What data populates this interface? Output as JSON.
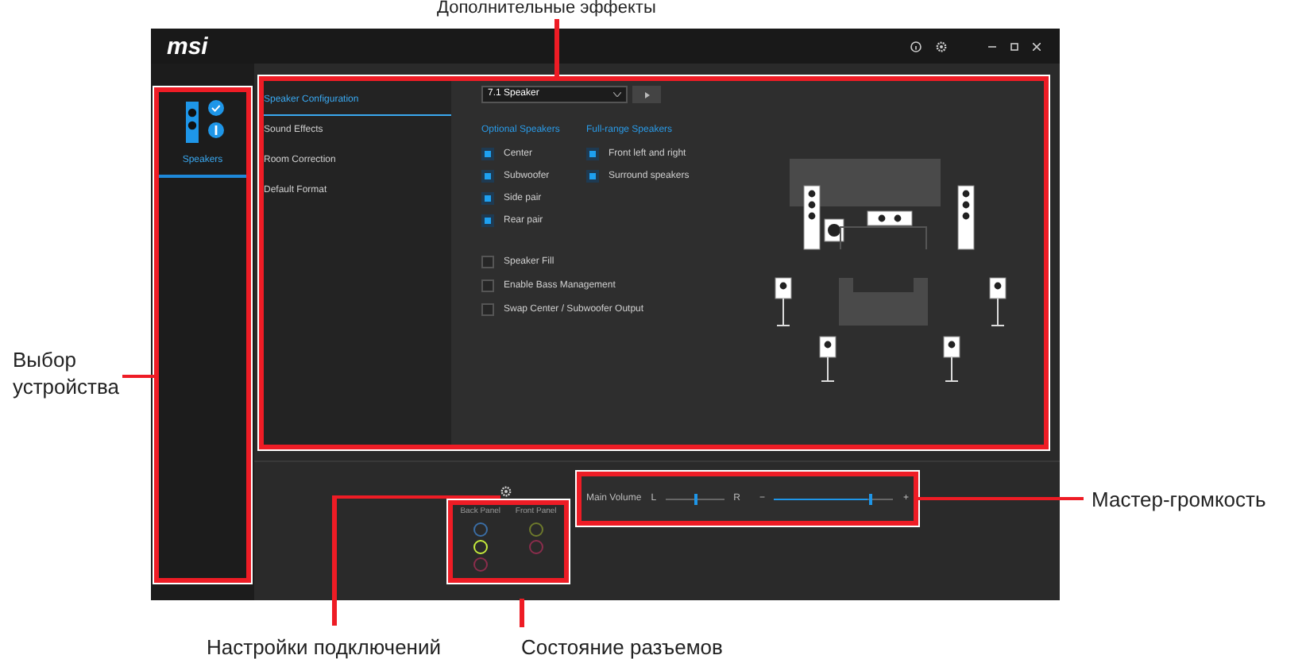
{
  "annotations": {
    "top": "Дополнительные эффекты",
    "left": "Выбор устройства",
    "right": "Мастер-громкость",
    "bottom_left": "Настройки подключений",
    "bottom_right": "Состояние разъемов"
  },
  "window": {
    "logo": "msi"
  },
  "devices": [
    {
      "label": "Speakers",
      "selected": true
    }
  ],
  "nav": [
    {
      "label": "Speaker Configuration",
      "selected": true
    },
    {
      "label": "Sound Effects",
      "selected": false
    },
    {
      "label": "Room Correction",
      "selected": false
    },
    {
      "label": "Default Format",
      "selected": false
    }
  ],
  "speaker_config": {
    "dropdown": "7.1 Speaker",
    "optional_heading": "Optional Speakers",
    "fullrange_heading": "Full-range Speakers",
    "optional": [
      {
        "label": "Center",
        "checked": true
      },
      {
        "label": "Subwoofer",
        "checked": true
      },
      {
        "label": "Side pair",
        "checked": true
      },
      {
        "label": "Rear pair",
        "checked": true
      }
    ],
    "fullrange": [
      {
        "label": "Front left and right",
        "checked": true
      },
      {
        "label": "Surround speakers",
        "checked": true
      }
    ],
    "options": [
      {
        "label": "Speaker Fill",
        "checked": false
      },
      {
        "label": "Enable Bass Management",
        "checked": false
      },
      {
        "label": "Swap Center / Subwoofer Output",
        "checked": false
      }
    ]
  },
  "jacks": {
    "back_label": "Back Panel",
    "front_label": "Front Panel",
    "back": [
      {
        "color": "#3b6ea5"
      },
      {
        "color": "#c6ec3c"
      },
      {
        "color": "#8b2d4c"
      }
    ],
    "front": [
      {
        "color": "#6e7a2c"
      },
      {
        "color": "#8b2d4c"
      }
    ]
  },
  "volume": {
    "label": "Main Volume",
    "left": "L",
    "right": "R",
    "balance": {
      "level": 0.5
    },
    "minus": "−",
    "plus": "+",
    "main": {
      "level": 0.78
    }
  }
}
